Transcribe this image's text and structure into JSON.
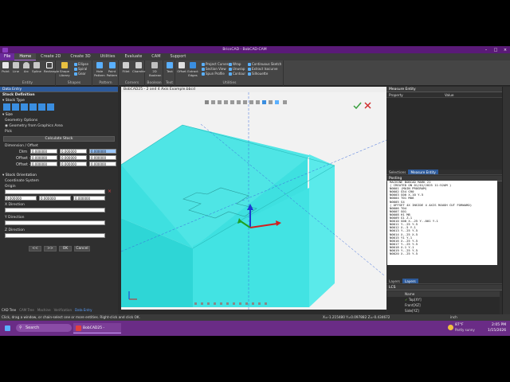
{
  "window": {
    "title": "BricsCAD - BobCAD-CAM"
  },
  "menu": {
    "file": "File",
    "tabs": [
      "Home",
      "Create 2D",
      "Create 3D",
      "Utilities",
      "Evaluate",
      "CAM",
      "Support"
    ]
  },
  "ribbon": {
    "groups": [
      "Entity",
      "Shapes",
      "Pattern",
      "Corners",
      "Boolean",
      "Text",
      "Utilities"
    ],
    "entity": [
      "Point",
      "Line",
      "Arc",
      "Spline",
      "Rectangle"
    ],
    "shapes": [
      "Shape Library",
      "Ellipse",
      "Spiral",
      "Gear"
    ],
    "pattern": [
      "Hole Pattern",
      "Point Pattern"
    ],
    "corners": [
      "Fillet",
      "Chamfer"
    ],
    "boolean": [
      "2D Boolean"
    ],
    "text": [
      "Text"
    ],
    "utilities_buttons": [
      "Offset",
      "Extract Edges"
    ],
    "utilities_small": [
      "Project Curves",
      "Section View",
      "Spun Profile",
      "Wrap",
      "Unwrap",
      "Contour",
      "Continuous Sketch",
      "Extract Isocurve",
      "Silhouette"
    ]
  },
  "left_panel": {
    "header": "Data Entry",
    "section": "Stock Definition",
    "stock_type": "Stock Type",
    "size": "Size",
    "geometry_options": "Geometry Options",
    "geometry_from_graphics": "Geometry from Graphics Area",
    "pick": "Pick",
    "calculate_stock": "Calculate Stock",
    "dimension_offset": "Dimension / Offset",
    "dim_label": "Dim",
    "offset_plus_label": "Offset +",
    "offset_minus_label": "Offset -",
    "dim_values": [
      "0.000000",
      "0.000000",
      "0.000000"
    ],
    "offset_plus_values": [
      "0.000000",
      "0.000000",
      "0.000000"
    ],
    "offset_minus_values": [
      "0.000000",
      "0.000000",
      "0.000000"
    ],
    "stock_orientation": "Stock Orientation",
    "coordinate_system": "Coordinate System",
    "origin": "Origin",
    "origin_values": [
      "0.000000",
      "0.000000",
      "0.000000"
    ],
    "x_direction": "X Direction",
    "y_direction": "Y Direction",
    "z_direction": "Z Direction",
    "buttons": [
      "<<",
      ">>",
      "OK",
      "Cancel"
    ]
  },
  "bottom_tabs": [
    "CAD Tree",
    "CAM Tree",
    "Machine",
    "Verification",
    "Data Entry"
  ],
  "viewport": {
    "doc_title": "BobCAD25 - 2 and 4 Axis Example.bbcd"
  },
  "right_panel": {
    "header": "Measure Entity",
    "prop_cols": [
      "Property",
      "Value"
    ],
    "tabs": [
      "Selections",
      "Measure Entity"
    ],
    "posting_header": "Posting",
    "posting_lines": [
      "MACHINE BOBCAD MARK 21",
      "( CREATED ON 01/01/2025 11:52AM )",
      "N0001 (MAIN PROGRAM)",
      "N0002 G54 G90",
      "N0003 G00 X-10 Y-5",
      "N0004 T01 M06",
      "N0005 S4",
      "( OFFSET 4X INSIDE 4 AXIS ROUGH CUT FORWARD)",
      "N0006 T04",
      "N0007 G01",
      "N0008 H1 M8",
      "N0009 G1 Z-1",
      "N0010 G00 X-.25 Y-.001 Y-1",
      "N0011 Y-.25 Y-5",
      "N0012 X-.5 Y-1",
      "N0013 Y-.25 Y-5",
      "N0014 X-.25 X-5",
      "N0015 Y1 Y-1",
      "N0016 X-.25 Y-5",
      "N0017 Y-.25 Y-5",
      "N0018 X-1 Y-1",
      "N0019 Y-.25 Y-5",
      "N0020 X-.25 Y-5"
    ],
    "layers_header": "Layers",
    "layers_tab": "Layers",
    "lcs_header": "LCS",
    "lcs_col": "Name",
    "lcs_rows": [
      "Top[XY]",
      "Front[XZ]",
      "Side[YZ]"
    ]
  },
  "statusbar": {
    "hint": "Click, drag a window, or chain-select one or more entities. Right-click and click OK.",
    "coords": "X=-1.215480  Y=0.097882  Z=-0.434672",
    "units": "inch"
  },
  "taskbar": {
    "search": "Search",
    "app": "BobCAD25 - BobCAD-CA",
    "weather_temp": "87°F",
    "weather_desc": "Partly sunny",
    "time": "2:05 PM",
    "date": "1/15/2026"
  },
  "colors": {
    "accent": "#6a2a9a",
    "stock": "#4de8e8",
    "taskbar": "#6a2c86"
  }
}
